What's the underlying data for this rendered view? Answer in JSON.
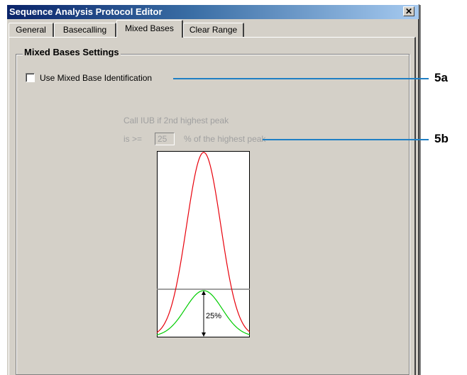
{
  "window": {
    "title": "Sequence Analysis Protocol Editor",
    "close_glyph": "✕"
  },
  "tabs": [
    {
      "label": "General",
      "active": false
    },
    {
      "label": "Basecalling",
      "active": false
    },
    {
      "label": "Mixed Bases",
      "active": true
    },
    {
      "label": "Clear Range",
      "active": false
    }
  ],
  "mixed_bases": {
    "group_title": "Mixed Bases Settings",
    "use_mixed_base_label": "Use Mixed Base Identification",
    "use_mixed_base_checked": false,
    "call_iub_line": "Call IUB if 2nd highest peak",
    "is_gte_label": "is >=",
    "threshold_value": "25",
    "percent_suffix": "% of the highest peak",
    "diagram_percent_label": "25%",
    "threshold_fraction": 0.25
  },
  "callouts": {
    "a": "5a",
    "b": "5b"
  },
  "colors": {
    "highest_peak": "#e8000b",
    "second_peak": "#00cc00",
    "callout_line": "#1f7fc4"
  }
}
